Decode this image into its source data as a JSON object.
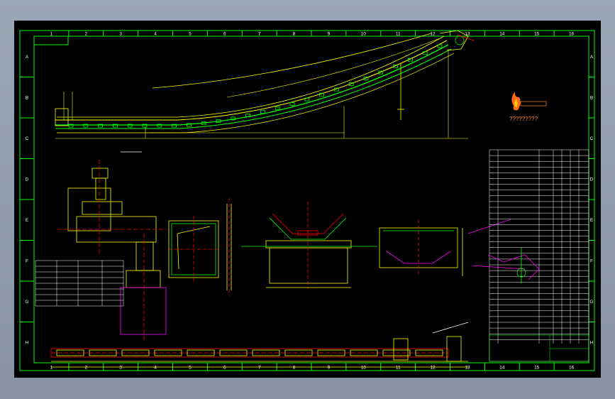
{
  "drawing": {
    "column_numbers": [
      "1",
      "2",
      "3",
      "4",
      "5",
      "6",
      "7",
      "8",
      "9",
      "10",
      "11",
      "12",
      "13",
      "14",
      "15",
      "16"
    ],
    "row_letters": [
      "A",
      "B",
      "C",
      "D",
      "E",
      "F",
      "G",
      "H"
    ],
    "logo_caption": "?????????",
    "colors": {
      "background": "#000000",
      "frame": "#00ff00",
      "conveyor": "#ffff00",
      "section": "#ff0000",
      "accent": "#ff00ff",
      "text": "#ffffff"
    }
  }
}
